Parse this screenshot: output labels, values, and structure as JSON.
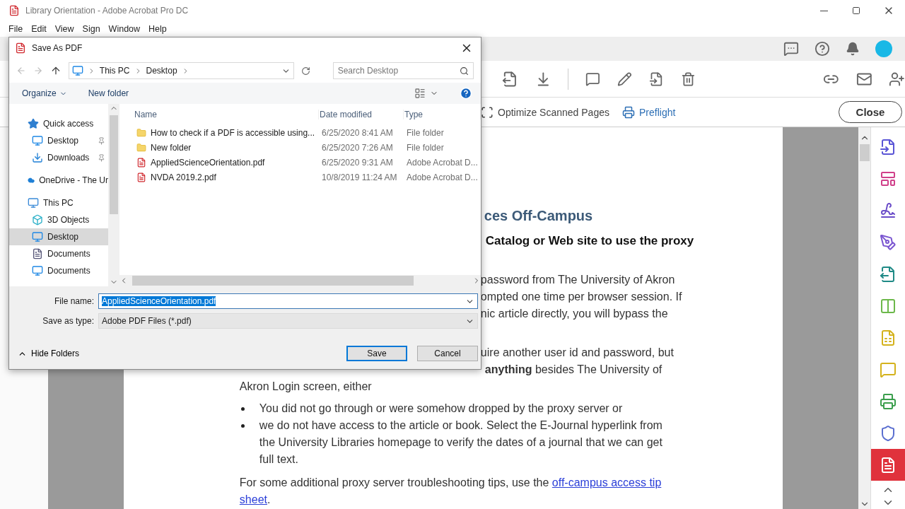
{
  "window": {
    "title": "Library Orientation - Adobe Acrobat Pro DC"
  },
  "menu": [
    "File",
    "Edit",
    "View",
    "Sign",
    "Window",
    "Help"
  ],
  "tool_row": [
    {
      "label": "Optimize Scanned Pages",
      "selected": false
    },
    {
      "label": "Preflight",
      "selected": true
    }
  ],
  "close_button": "Close",
  "document": {
    "heading": "ces Off-Campus",
    "subheading": "Catalog or Web site to use the proxy",
    "lines_1": [
      "password from The University of Akron",
      "ompted one time per browser session.  If",
      "nic article directly, you will bypass the"
    ],
    "lines_2": [
      "uire another user id and password, but",
      "**anything** besides The University of"
    ],
    "paragraph": "Akron Login screen, either",
    "bullets": [
      "You did not go through or were somehow dropped by the proxy server or",
      "we do not have access to the article or book.  Select the E-Journal hyperlink from the University Libraries homepage to verify the dates of a journal that we can get full text."
    ],
    "closing": {
      "text": "For some additional proxy server troubleshooting tips, use the ",
      "links": [
        "off-campus access tip",
        "sheet"
      ],
      "end": "."
    }
  },
  "right_tools": [
    {
      "color": "#5a55d6",
      "selected": false
    },
    {
      "color": "#d0408a",
      "selected": false
    },
    {
      "color": "#6a4cc8",
      "selected": false
    },
    {
      "color": "#7a55d0",
      "selected": false
    },
    {
      "color": "#1f8a86",
      "selected": false
    },
    {
      "color": "#6cb84a",
      "selected": false
    },
    {
      "color": "#d4b21c",
      "selected": false
    },
    {
      "color": "#d4b21c",
      "selected": false
    },
    {
      "color": "#3a9e4c",
      "selected": false
    },
    {
      "color": "#5b6fd0",
      "selected": false
    },
    {
      "color": "#e0323c",
      "selected": true
    }
  ],
  "dialog": {
    "title": "Save As PDF",
    "breadcrumbs": [
      "This PC",
      "Desktop"
    ],
    "search": {
      "placeholder": "Search Desktop"
    },
    "commands": [
      "Organize",
      "New folder"
    ],
    "nav": [
      {
        "label": "Quick access",
        "kind": "star",
        "selected": false,
        "children": [
          {
            "label": "Desktop",
            "kind": "desktop",
            "pinned": true,
            "selected": false
          },
          {
            "label": "Downloads",
            "kind": "download",
            "pinned": true,
            "selected": false
          }
        ]
      },
      {
        "label": "OneDrive - The Ur",
        "kind": "cloud",
        "selected": false
      },
      {
        "label": "This PC",
        "kind": "pc",
        "selected": false,
        "children": [
          {
            "label": "3D Objects",
            "kind": "cube",
            "pinned": false,
            "selected": false
          },
          {
            "label": "Desktop",
            "kind": "desktop",
            "pinned": false,
            "selected": true
          },
          {
            "label": "Documents",
            "kind": "document",
            "pinned": false,
            "selected": false
          },
          {
            "label": "Documents",
            "kind": "desktop",
            "pinned": false,
            "selected": false
          }
        ]
      }
    ],
    "columns": [
      "Name",
      "Date modified",
      "Type"
    ],
    "files": [
      {
        "name": "How to check if a PDF is accessible using...",
        "date": "6/25/2020 8:41 AM",
        "type": "File folder",
        "kind": "folder"
      },
      {
        "name": "New folder",
        "date": "6/25/2020 7:26 AM",
        "type": "File folder",
        "kind": "folder"
      },
      {
        "name": "AppliedScienceOrientation.pdf",
        "date": "6/25/2020 9:31 AM",
        "type": "Adobe Acrobat D...",
        "kind": "pdf"
      },
      {
        "name": "NVDA 2019.2.pdf",
        "date": "10/8/2019 11:24 AM",
        "type": "Adobe Acrobat D...",
        "kind": "pdf"
      }
    ],
    "file_name": {
      "label": "File name:",
      "value": "AppliedScienceOrientation.pdf"
    },
    "save_type": {
      "label": "Save as type:",
      "value": "Adobe PDF Files (*.pdf)"
    },
    "hide_folders": "Hide Folders",
    "buttons": [
      {
        "label": "Save",
        "default": true
      },
      {
        "label": "Cancel",
        "default": false
      }
    ]
  }
}
